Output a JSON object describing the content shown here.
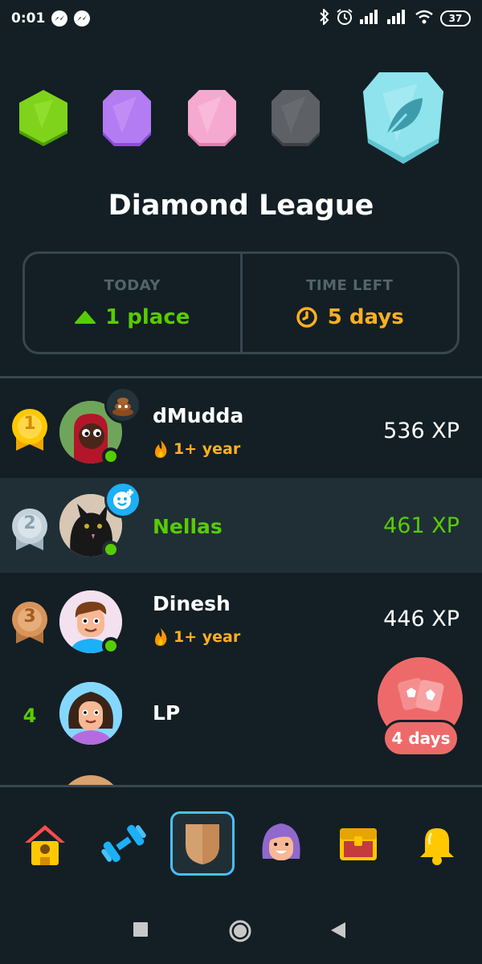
{
  "status_bar": {
    "time": "0:01",
    "battery": "37",
    "icons": [
      "messenger-icon",
      "messenger-icon",
      "bluetooth-icon",
      "alarm-icon",
      "signal-icon",
      "signal-icon",
      "wifi-icon",
      "battery-icon"
    ]
  },
  "league": {
    "badges": [
      "green-league-badge",
      "purple-league-badge",
      "pink-league-badge",
      "gray-league-badge",
      "diamond-league-badge"
    ],
    "title": "Diamond League"
  },
  "stats": {
    "today_label": "TODAY",
    "today_value": "1 place",
    "time_left_label": "TIME LEFT",
    "time_left_value": "5 days"
  },
  "leaderboard": [
    {
      "rank": "1",
      "name": "dMudda",
      "streak": "1+ year",
      "xp": "536 XP",
      "highlight": false,
      "mini_badge": "poop-emoji-icon"
    },
    {
      "rank": "2",
      "name": "Nellas",
      "streak": "",
      "xp": "461 XP",
      "highlight": true,
      "mini_badge": "plus-face-icon"
    },
    {
      "rank": "3",
      "name": "Dinesh",
      "streak": "1+ year",
      "xp": "446 XP",
      "highlight": false,
      "mini_badge": ""
    },
    {
      "rank": "4",
      "name": "LP",
      "streak": "",
      "xp": "",
      "highlight": false,
      "mini_badge": ""
    }
  ],
  "floating_chest": {
    "label": "4 days"
  },
  "bottom_nav": [
    "home-icon",
    "dumbbell-icon",
    "league-shield-icon",
    "profile-icon",
    "treasure-chest-icon",
    "bell-icon"
  ],
  "colors": {
    "background": "#131f24",
    "highlight_row": "#202f36",
    "border": "#37464f",
    "green": "#58cc02",
    "orange": "#ffb020",
    "active_nav": "#49c0f8",
    "chest": "#ee6a6a"
  }
}
